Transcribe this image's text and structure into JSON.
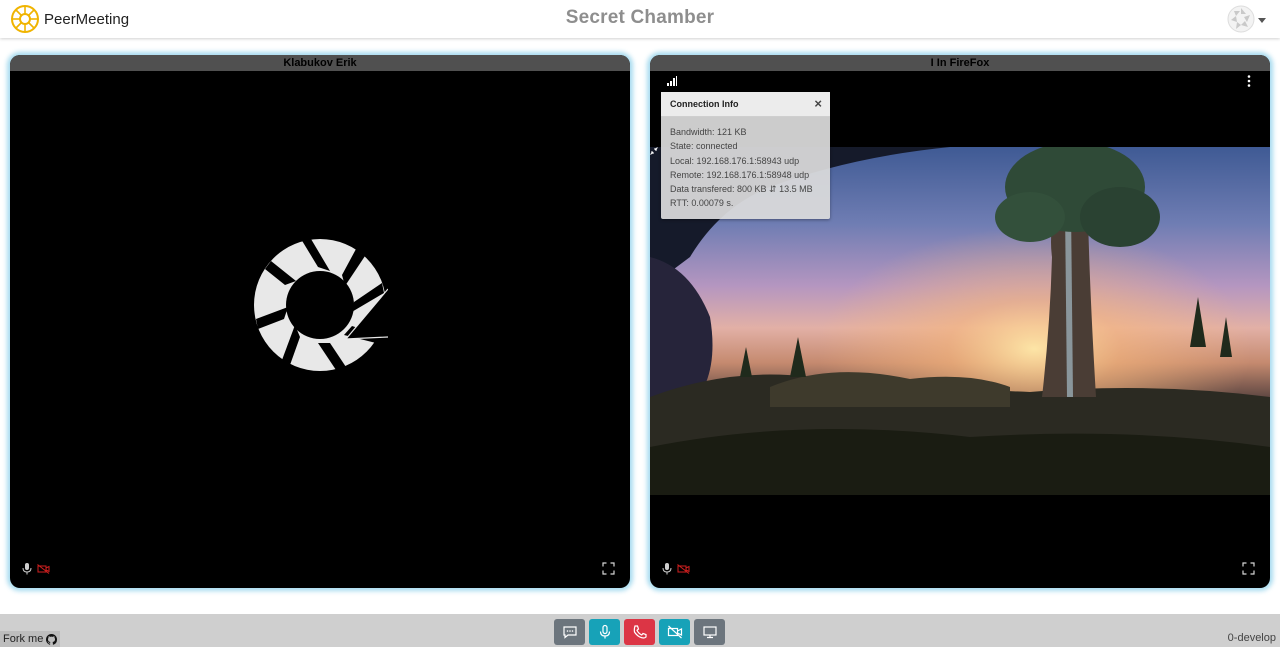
{
  "header": {
    "app_name": "PeerMeeting",
    "room_title": "Secret Chamber",
    "icons": [
      "peermeeting-logo-icon",
      "user-avatar-icon",
      "chevron-down-icon"
    ]
  },
  "panels": [
    {
      "title": "Klabukov Erik",
      "placeholder_icon": "aperture-icon",
      "status_icons": [
        "microphone-icon",
        "camera-off-icon"
      ],
      "action_icons": [
        "fullscreen-icon"
      ]
    },
    {
      "title": "I In FireFox",
      "status_icons": [
        "microphone-icon",
        "camera-off-icon"
      ],
      "action_icons": [
        "signal-strength-icon",
        "more-vertical-icon",
        "fullscreen-icon",
        "shrink-icon"
      ]
    }
  ],
  "connection_info": {
    "title": "Connection Info",
    "close": "×",
    "lines": [
      "Bandwidth: 121 KB",
      "State: connected",
      "Local: 192.168.176.1:58943 udp",
      "Remote: 192.168.176.1:58948 udp",
      "Data transfered: 800 KB ⇵ 13.5 MB",
      "RTT: 0.00079 s."
    ]
  },
  "footer": {
    "fork_label": "Fork me",
    "version": "0-develop",
    "controls": [
      {
        "name": "chat",
        "icon": "chat-icon",
        "color": "#6c757d"
      },
      {
        "name": "microphone",
        "icon": "microphone-icon",
        "color": "#17a2b8"
      },
      {
        "name": "hangup",
        "icon": "phone-icon",
        "color": "#dc3545"
      },
      {
        "name": "camera",
        "icon": "camera-off-icon",
        "color": "#17a2b8"
      },
      {
        "name": "screen-share",
        "icon": "monitor-icon",
        "color": "#6c757d"
      }
    ]
  }
}
